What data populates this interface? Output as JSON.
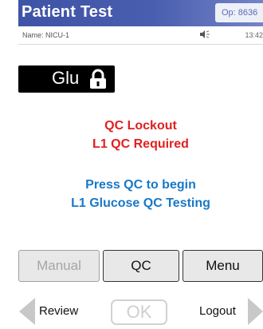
{
  "header": {
    "title": "Patient Test",
    "operator": "Op: 8636"
  },
  "info": {
    "name": "Name: NICU-1",
    "time": "13:42",
    "sound_icon": "speaker-icon"
  },
  "test": {
    "label": "Glu",
    "lock_icon": "lock-icon"
  },
  "messages": {
    "lockout_line1": "QC Lockout",
    "lockout_line2": "L1 QC Required",
    "instruction_line1": "Press QC to begin",
    "instruction_line2": "L1 Glucose QC Testing"
  },
  "buttons": {
    "manual": "Manual",
    "qc": "QC",
    "menu": "Menu"
  },
  "nav": {
    "review": "Review",
    "ok": "OK",
    "logout": "Logout"
  },
  "colors": {
    "title_bar": "#4a5eb0",
    "alert_red": "#e02020",
    "info_blue": "#1878c8"
  }
}
